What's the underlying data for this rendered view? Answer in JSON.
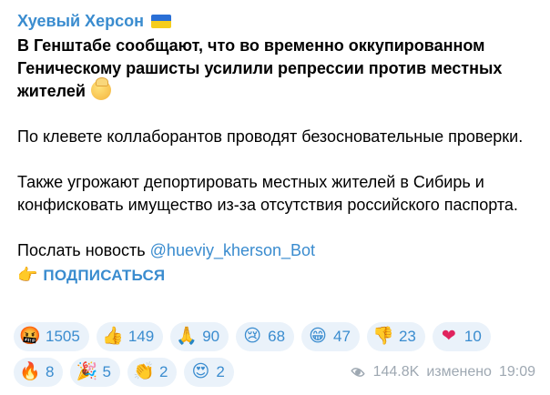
{
  "post": {
    "channel_name": "Хуевый Херсон",
    "headline_line1": "В Генштабе сообщают, что во временно оккупированном",
    "headline_line2": "Геническому рашисты усилили репрессии против местных",
    "headline_line3": "жителей",
    "paragraph1": "По клевете коллаборантов проводят безосновательные проверки.",
    "paragraph2": "Также угрожают депортировать местных жителей в Сибирь и конфисковать имущество из-за отсутствия российского паспорта.",
    "send_news_label": "Послать новость",
    "bot_link": "@hueviy_kherson_Bot",
    "subscribe_label": "ПОДПИСАТЬСЯ"
  },
  "reactions": [
    {
      "icon": "🤬",
      "icon_name": "cursing-face-icon",
      "count": "1505"
    },
    {
      "icon": "👍",
      "icon_name": "thumbs-up-icon",
      "count": "149"
    },
    {
      "icon": "🙏",
      "icon_name": "folded-hands-icon",
      "count": "90"
    },
    {
      "icon": "😢",
      "icon_name": "crying-face-icon",
      "count": "68"
    },
    {
      "icon": "😁",
      "icon_name": "grinning-face-icon",
      "count": "47"
    },
    {
      "icon": "👎",
      "icon_name": "thumbs-down-icon",
      "count": "23"
    },
    {
      "icon": "❤",
      "icon_name": "red-heart-icon",
      "count": "10"
    },
    {
      "icon": "🔥",
      "icon_name": "fire-icon",
      "count": "8"
    },
    {
      "icon": "🎉",
      "icon_name": "party-popper-icon",
      "count": "5"
    },
    {
      "icon": "👏",
      "icon_name": "clapping-hands-icon",
      "count": "2"
    },
    {
      "icon": "😍",
      "icon_name": "heart-eyes-face-icon",
      "count": "2"
    }
  ],
  "meta": {
    "views": "144.8K",
    "edited_label": "изменено",
    "time": "19:09"
  },
  "colors": {
    "accent": "#3a8ccf",
    "reaction_bg": "#eaf2fa",
    "meta_text": "#9ea8b2"
  }
}
